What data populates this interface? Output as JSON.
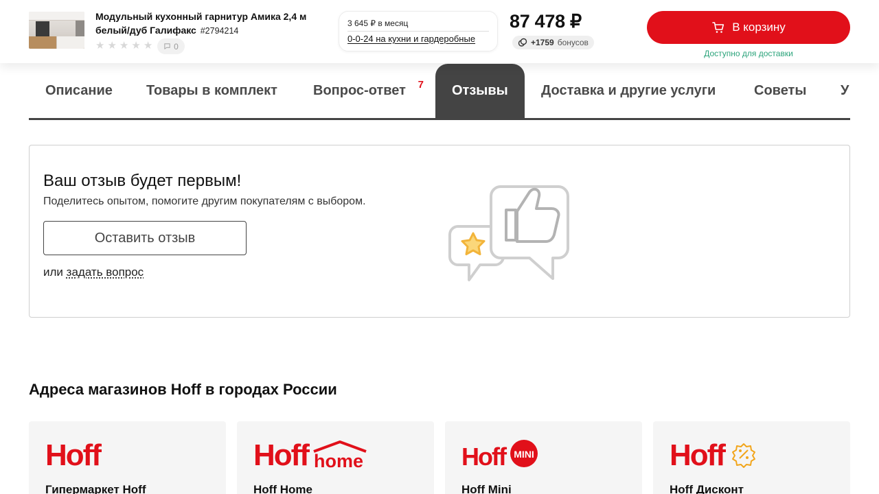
{
  "header": {
    "product_title": "Модульный кухонный гарнитур Амика 2,4 м белый/дуб Галифакс",
    "sku": "#2794214",
    "reviews_count": "0",
    "credit_monthly": "3 645 ₽ в месяц",
    "credit_offer": "0-0-24 на кухни и гардеробные",
    "price": "87 478 ₽",
    "bonus_amount": "+1759",
    "bonus_label": "бонусов",
    "cart_button": "В корзину",
    "availability": "Доступно для доставки"
  },
  "tabs": [
    {
      "label": "Описание"
    },
    {
      "label": "Товары в комплект"
    },
    {
      "label": "Вопрос-ответ",
      "badge": "7"
    },
    {
      "label": "Отзывы",
      "active": true
    },
    {
      "label": "Доставка и другие услуги"
    },
    {
      "label": "Советы"
    },
    {
      "label": "У"
    }
  ],
  "review_box": {
    "title": "Ваш отзыв будет первым!",
    "subtitle": "Поделитесь опытом, помогите другим покупателям с выбором.",
    "button": "Оставить отзыв",
    "or_text": "или",
    "ask_link": "задать вопрос"
  },
  "stores": {
    "title": "Адреса магазинов Hoff в городах России",
    "items": [
      {
        "name": "Гипермаркет Hoff",
        "logo": "hoff-logo"
      },
      {
        "name": "Hoff Home",
        "logo": "hoff-home-logo"
      },
      {
        "name": "Hoff Mini",
        "logo": "hoff-mini-logo"
      },
      {
        "name": "Hoff Дисконт",
        "logo": "hoff-discount-logo"
      }
    ]
  },
  "colors": {
    "brand_red": "#e1101a",
    "tab_active": "#444444",
    "availability_green": "#2aa37a",
    "star_yellow": "#f7c948"
  }
}
